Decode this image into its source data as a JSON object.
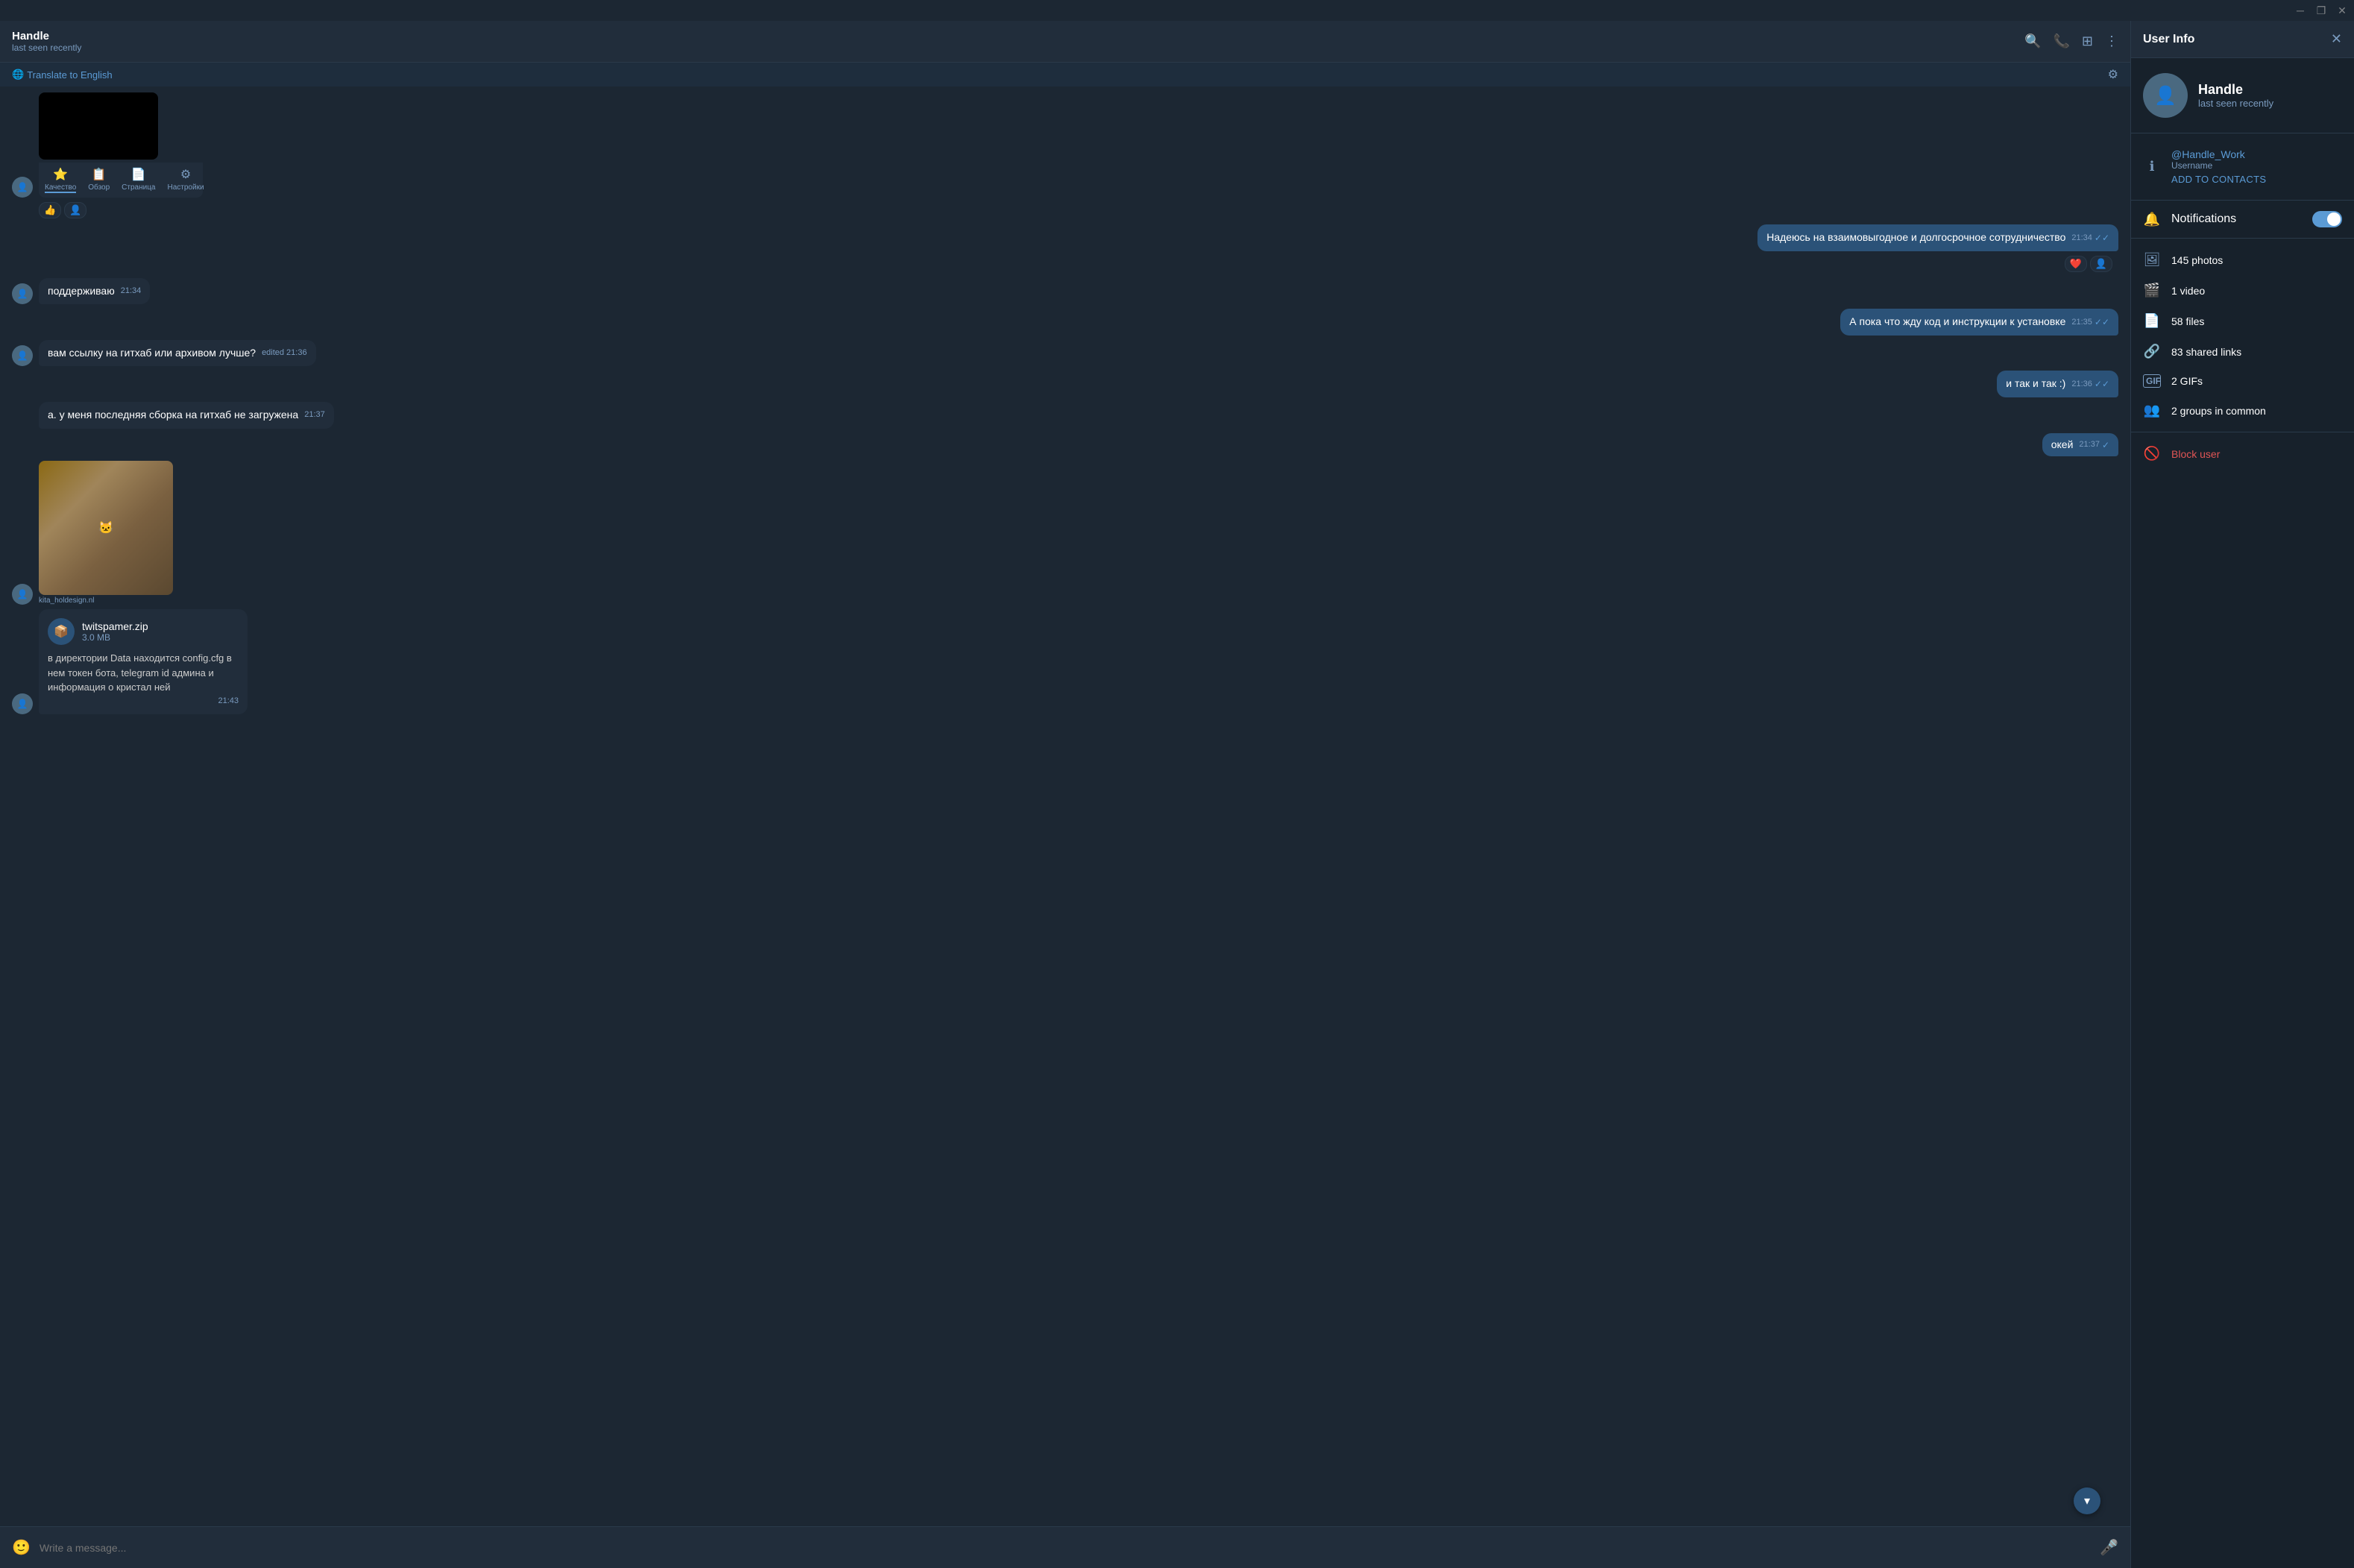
{
  "titlebar": {
    "minimize_label": "─",
    "maximize_label": "❐",
    "close_label": "✕"
  },
  "chat": {
    "header": {
      "name": "Handle",
      "status": "last seen recently"
    },
    "translate_btn": "Translate to English",
    "messages": [
      {
        "id": "msg-reaction",
        "type": "outgoing",
        "has_avatar": false,
        "reactions": [
          "👍",
          "👤"
        ]
      },
      {
        "id": "msg-1",
        "type": "outgoing",
        "text": "Надеюсь на взаимовыгодное и долгосрочное сотрудничество",
        "time": "21:34",
        "reactions": [
          "❤️",
          "👤"
        ],
        "ticks": "✓✓"
      },
      {
        "id": "msg-2",
        "type": "incoming",
        "text": "поддерживаю",
        "time": "21:34"
      },
      {
        "id": "msg-3",
        "type": "outgoing",
        "text": "А пока что жду код и инструкции к установке",
        "time": "21:35",
        "ticks": "✓✓"
      },
      {
        "id": "msg-4",
        "type": "incoming",
        "text": "вам ссылку на гитхаб или архивом лучше?",
        "time": "21:36",
        "edited": true
      },
      {
        "id": "msg-5",
        "type": "outgoing",
        "text": "и так и так :)",
        "time": "21:36",
        "ticks": "✓✓"
      },
      {
        "id": "msg-6",
        "type": "incoming",
        "text": "а. у меня последняя сборка на гитхаб не загружена",
        "time": "21:37"
      },
      {
        "id": "msg-7",
        "type": "outgoing",
        "text": "окей",
        "time": "21:37",
        "ticks": "✓"
      },
      {
        "id": "msg-8",
        "type": "incoming",
        "has_image": true,
        "image_label": "cat image",
        "image_caption": "kita_holdesign.nl"
      },
      {
        "id": "msg-9",
        "type": "incoming",
        "has_file": true,
        "file_name": "twitspamer.zip",
        "file_size": "3.0 MB",
        "file_text": "в директории Data находится config.cfg в нем токен бота, telegram id админа и информация о кристал ней",
        "time": "21:43"
      }
    ],
    "input_placeholder": "Write a message...",
    "video_controls": [
      {
        "label": "Качество",
        "active": true
      },
      {
        "label": "Обзор"
      },
      {
        "label": "Страница"
      },
      {
        "label": "Настройки"
      }
    ]
  },
  "user_info": {
    "title": "User Info",
    "name": "Handle",
    "status": "last seen recently",
    "username": "@Handle_Work",
    "username_label": "Username",
    "add_contacts": "ADD TO CONTACTS",
    "notifications_label": "Notifications",
    "media": [
      {
        "icon": "🖼",
        "label": "145 photos"
      },
      {
        "icon": "🎬",
        "label": "1 video"
      },
      {
        "icon": "📄",
        "label": "58 files"
      },
      {
        "icon": "🔗",
        "label": "83 shared links"
      },
      {
        "icon": "GIF",
        "label": "2 GIFs"
      },
      {
        "icon": "👥",
        "label": "2 groups in common"
      }
    ],
    "block_label": "Block user"
  }
}
